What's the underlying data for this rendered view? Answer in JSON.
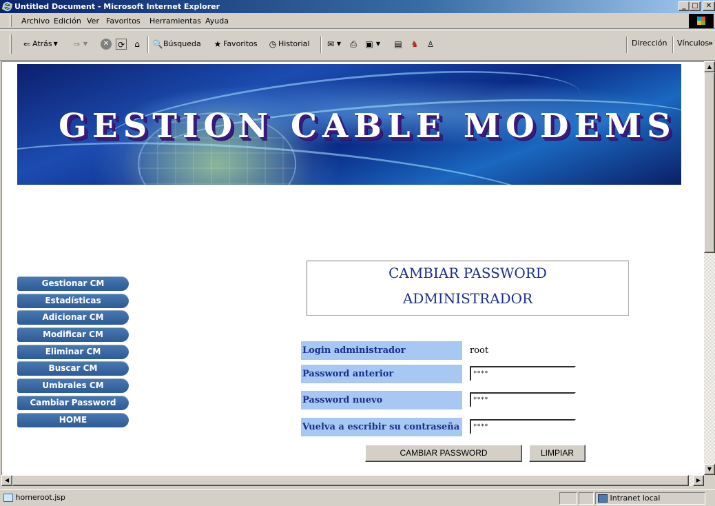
{
  "window": {
    "title": "Untitled Document - Microsoft Internet Explorer",
    "minimize": "_",
    "maximize": "□",
    "close": "✕"
  },
  "menu": [
    "Archivo",
    "Edición",
    "Ver",
    "Favoritos",
    "Herramientas",
    "Ayuda"
  ],
  "toolbar": {
    "back": "Atrás",
    "search": "Búsqueda",
    "favorites": "Favoritos",
    "history": "Historial",
    "address_label": "Dirección",
    "links_label": "Vínculos",
    "links_chevron": "»"
  },
  "banner": {
    "headline": "GESTION CABLE MODEMS"
  },
  "nav": [
    {
      "label": "Gestionar CM"
    },
    {
      "label": "Estadísticas"
    },
    {
      "label": "Adicionar CM"
    },
    {
      "label": "Modificar CM"
    },
    {
      "label": "Eliminar CM"
    },
    {
      "label": "Buscar CM"
    },
    {
      "label": "Umbrales CM"
    },
    {
      "label": "Cambiar Password"
    },
    {
      "label": "HOME"
    }
  ],
  "heading": {
    "line1": "CAMBIAR PASSWORD",
    "line2": "ADMINISTRADOR"
  },
  "form": {
    "login_label": "Login administrador",
    "login_value": "root",
    "old_password_label": "Password anterior",
    "old_password_value": "****",
    "new_password_label": "Password nuevo",
    "new_password_value": "****",
    "confirm_label": "Vuelva a escribir su contraseña",
    "confirm_value": "****",
    "submit_label": "CAMBIAR PASSWORD",
    "reset_label": "LIMPIAR"
  },
  "status": {
    "url": "homeroot.jsp",
    "zone": "Intranet local"
  },
  "colors": {
    "label_bg": "#a6c8f2",
    "label_text": "#1a2e8a",
    "nav_button": "#2d5b96"
  }
}
